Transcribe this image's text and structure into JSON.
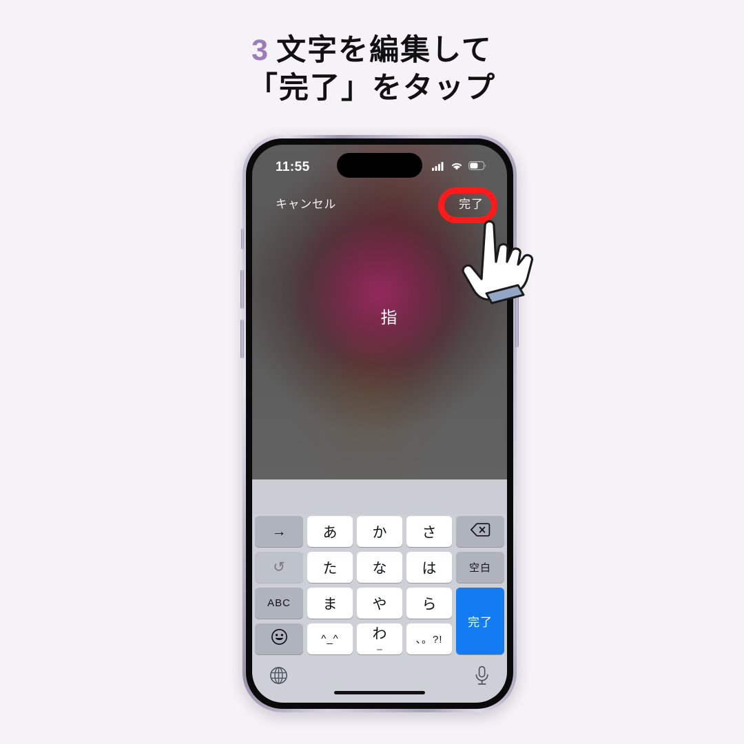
{
  "page": {
    "background_color": "#f5f3f7"
  },
  "title": {
    "step_number": "3",
    "step_number_color": "#9b7cb8",
    "line1": "文字を編集して",
    "line2": "「完了」をタップ"
  },
  "phone": {
    "status_bar": {
      "time": "11:55",
      "cellular_icon": "cellular-bars-icon",
      "wifi_icon": "wifi-icon",
      "battery_icon": "battery-icon"
    },
    "nav_bar": {
      "cancel_label": "キャンセル",
      "done_label": "完了",
      "highlight_color": "#fb1b1b"
    },
    "text_field": {
      "value": "指",
      "outline_color": "#fab74f"
    },
    "keyboard": {
      "predictive_bar_text": "",
      "rows": [
        {
          "left": {
            "label": "→",
            "type": "function"
          },
          "center": [
            "あ",
            "か",
            "さ"
          ],
          "right": {
            "label": "⌫",
            "type": "delete"
          }
        },
        {
          "left": {
            "label": "↺",
            "type": "undo"
          },
          "center": [
            "た",
            "な",
            "は"
          ],
          "right": {
            "label": "空白",
            "type": "space"
          }
        },
        {
          "left": {
            "label": "ABC",
            "type": "abc"
          },
          "center": [
            "ま",
            "や",
            "ら"
          ],
          "right": {
            "label": "完了",
            "type": "return"
          }
        },
        {
          "left": {
            "label": "☺",
            "type": "emoji"
          },
          "center": [
            "^_^",
            "わ",
            "、。?!"
          ],
          "right": null
        }
      ],
      "wa_sub": "_",
      "return_key_color": "#137cf3",
      "globe_icon": "globe-icon",
      "mic_icon": "microphone-icon"
    }
  },
  "overlay": {
    "hand_cursor_icon": "pointing-hand-cursor"
  }
}
